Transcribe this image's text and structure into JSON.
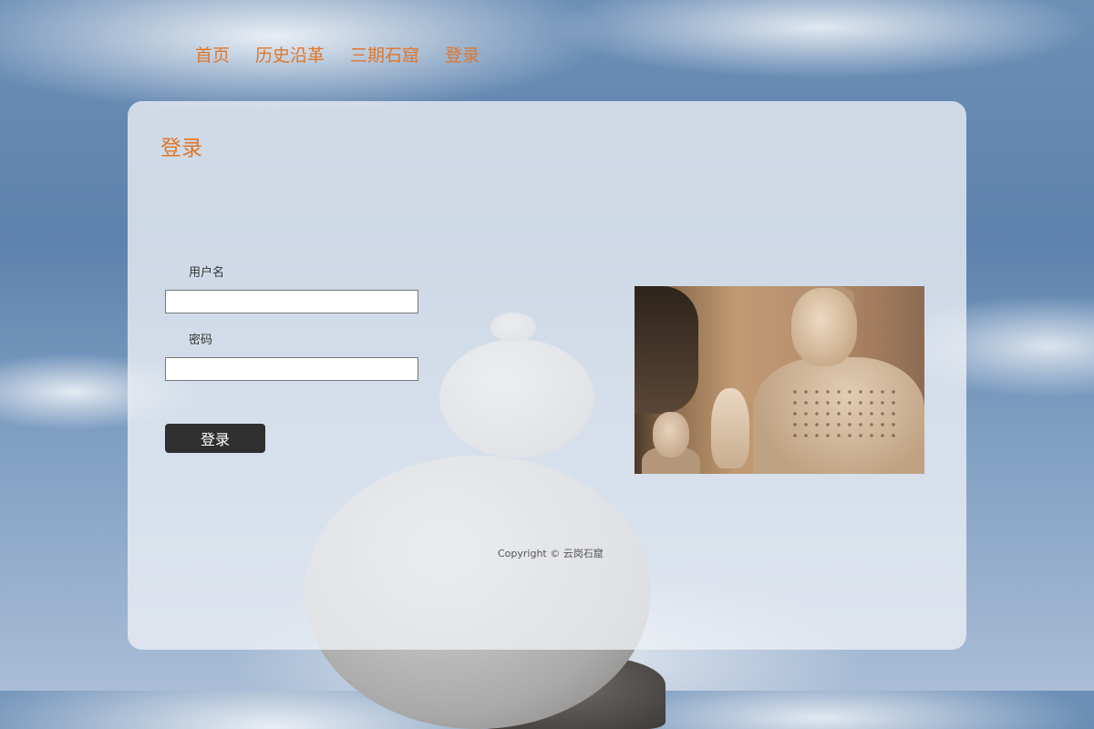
{
  "nav": {
    "items": [
      {
        "label": "首页"
      },
      {
        "label": "历史沿革"
      },
      {
        "label": "三期石窟"
      },
      {
        "label": "登录"
      }
    ]
  },
  "login": {
    "title": "登录",
    "username_label": "用户名",
    "username_value": "",
    "password_label": "密码",
    "password_value": "",
    "submit_label": "登录"
  },
  "footer": {
    "copyright": "Copyright © 云岗石窟"
  },
  "colors": {
    "accent": "#e0762a",
    "button": "#2f2f2f"
  },
  "icons": {
    "photo": "buddha-statue-photo"
  }
}
